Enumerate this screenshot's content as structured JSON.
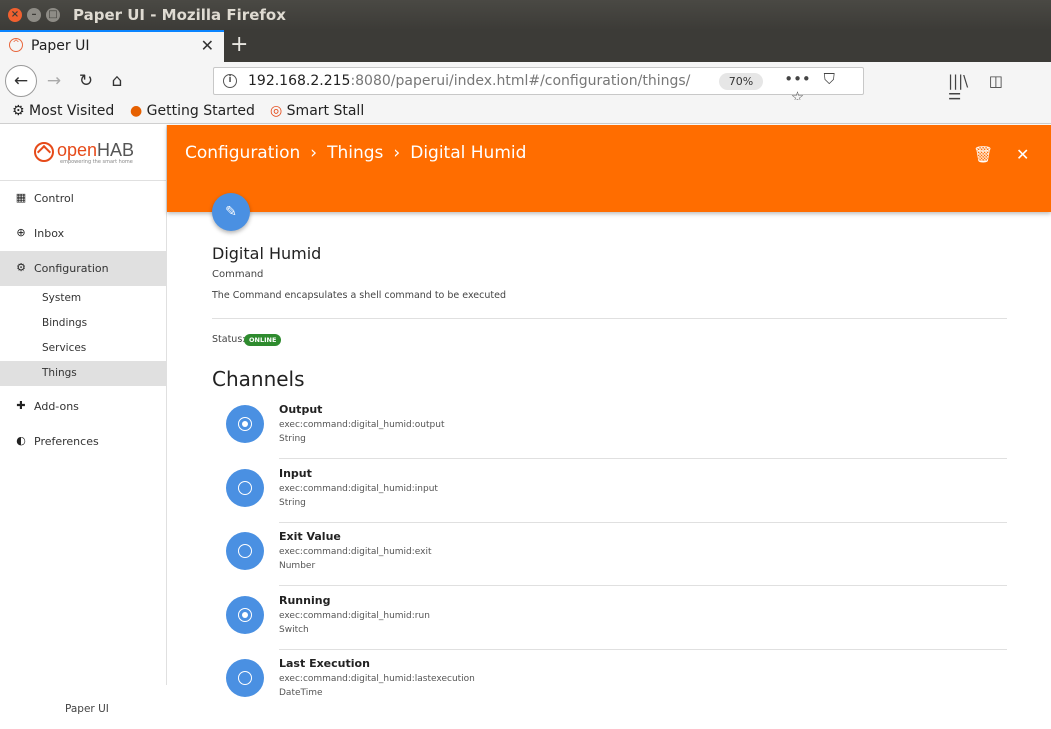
{
  "window": {
    "title": "Paper UI - Mozilla Firefox"
  },
  "tab": {
    "label": "Paper UI"
  },
  "nav": {
    "url_host": "192.168.2.215",
    "url_rest": ":8080/paperui/index.html#/configuration/things/",
    "zoom": "70%"
  },
  "bookmarks": [
    "Most Visited",
    "Getting Started",
    "Smart Stall"
  ],
  "logo": {
    "open": "open",
    "hab": "HAB",
    "tagline": "empowering the smart home"
  },
  "sidebar": {
    "items": [
      {
        "label": "Control",
        "icon": "dashboard-icon"
      },
      {
        "label": "Inbox",
        "icon": "add-circle-icon"
      },
      {
        "label": "Configuration",
        "icon": "gear-icon"
      }
    ],
    "subitems": [
      "System",
      "Bindings",
      "Services",
      "Things"
    ],
    "items_after": [
      {
        "label": "Add-ons",
        "icon": "puzzle-icon"
      },
      {
        "label": "Preferences",
        "icon": "contrast-icon"
      }
    ],
    "footer": "Paper UI"
  },
  "header": {
    "breadcrumb": [
      "Configuration",
      "Things",
      "Digital Humid"
    ]
  },
  "thing": {
    "name": "Digital Humid",
    "type": "Command",
    "description": "The Command encapsulates a shell command to be executed",
    "status_label": "Status:",
    "status": "ONLINE"
  },
  "channels_title": "Channels",
  "channels": [
    {
      "name": "Output",
      "uid": "exec:command:digital_humid:output",
      "type": "String",
      "linked": true
    },
    {
      "name": "Input",
      "uid": "exec:command:digital_humid:input",
      "type": "String",
      "linked": false
    },
    {
      "name": "Exit Value",
      "uid": "exec:command:digital_humid:exit",
      "type": "Number",
      "linked": false
    },
    {
      "name": "Running",
      "uid": "exec:command:digital_humid:run",
      "type": "Switch",
      "linked": true
    },
    {
      "name": "Last Execution",
      "uid": "exec:command:digital_humid:lastexecution",
      "type": "DateTime",
      "linked": false
    }
  ],
  "colors": {
    "header": "#ff6d00",
    "accent": "#4a90e2",
    "online": "#2e8b2e"
  }
}
